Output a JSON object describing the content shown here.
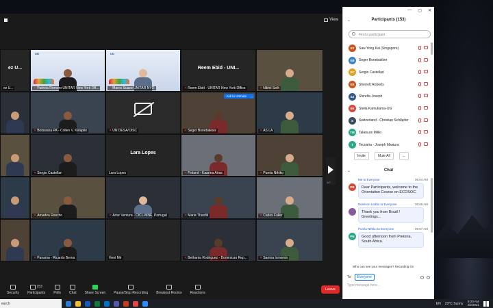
{
  "meeting": {
    "view_label": "View",
    "tiles": [
      {
        "id": "t0",
        "name": "ez U...",
        "kind": "big",
        "big": "ez U...",
        "mic": false
      },
      {
        "id": "t1",
        "name": "Patricia Romero UNITAR New York Off...",
        "kind": "slide",
        "mic": true
      },
      {
        "id": "t2",
        "name": "Marco Suazo UNITAR NYO",
        "kind": "slide",
        "mic": true
      },
      {
        "id": "t3",
        "name": "Reem Ebid - UNITAR New York Office",
        "kind": "big",
        "big": "Reem Ebid - UNI...",
        "mic": true
      },
      {
        "id": "t4",
        "name": "Nikhil Seth",
        "kind": "person",
        "mic": true
      },
      {
        "id": "t5",
        "name": "",
        "kind": "person",
        "mic": false
      },
      {
        "id": "t6",
        "name": "Botswana PA - Collen V. Kelapile",
        "kind": "person",
        "mic": true
      },
      {
        "id": "t7",
        "name": "UN DESA/OISC",
        "kind": "camoff",
        "mic": true
      },
      {
        "id": "t8",
        "name": "Seger Bonebakker",
        "kind": "person",
        "mic": true,
        "unmute": "Ask to Unmute",
        "more": "..."
      },
      {
        "id": "t9",
        "name": "AS LA",
        "kind": "person",
        "mic": true
      },
      {
        "id": "t10",
        "name": "",
        "kind": "person",
        "mic": false
      },
      {
        "id": "t11",
        "name": "Sergio Castellari",
        "kind": "person",
        "mic": true
      },
      {
        "id": "t12",
        "name": "Lara Lopes",
        "kind": "big",
        "big": "Lara Lopes",
        "mic": false
      },
      {
        "id": "t13",
        "name": "Finland - Kaarina Airas",
        "kind": "person",
        "mic": true
      },
      {
        "id": "t14",
        "name": "Pumla Nthiko",
        "kind": "person",
        "mic": true
      },
      {
        "id": "t15",
        "name": "",
        "kind": "person",
        "mic": false
      },
      {
        "id": "t16",
        "name": "Amadea Rascho",
        "kind": "person",
        "mic": true
      },
      {
        "id": "t17",
        "name": "Artur Ventura - CICL-MNE, Portugal",
        "kind": "person",
        "mic": true
      },
      {
        "id": "t18",
        "name": "Maria Theofili",
        "kind": "person",
        "mic": true
      },
      {
        "id": "t19",
        "name": "Carlos Fuller",
        "kind": "person",
        "mic": true
      },
      {
        "id": "t20",
        "name": "",
        "kind": "person",
        "mic": false
      },
      {
        "id": "t21",
        "name": "Panama - Ricardo Berna",
        "kind": "person",
        "mic": true
      },
      {
        "id": "t22",
        "name": "Heni Mir",
        "kind": "dark",
        "mic": false
      },
      {
        "id": "t23",
        "name": "Bethania Rodriguez - Dominican Rep...",
        "kind": "person",
        "mic": true
      },
      {
        "id": "t24",
        "name": "Samira Ismomin",
        "kind": "person",
        "mic": true
      }
    ],
    "pager": "1/7",
    "toolbar": [
      {
        "id": "security",
        "label": "Security"
      },
      {
        "id": "participants",
        "label": "Participants",
        "count": "153"
      },
      {
        "id": "polls",
        "label": "Polls"
      },
      {
        "id": "chat",
        "label": "Chat"
      },
      {
        "id": "share",
        "label": "Share Screen"
      },
      {
        "id": "record",
        "label": "Pause/Stop Recording"
      },
      {
        "id": "breakout",
        "label": "Breakout Rooms"
      },
      {
        "id": "reactions",
        "label": "Reactions"
      }
    ],
    "leave_label": "Leave"
  },
  "panel": {
    "title": "Participants (153)",
    "find_placeholder": "Find a participant",
    "participants": [
      {
        "initials": "SY",
        "name": "Saw Yong Kai (Singapore)",
        "color": "#c8541e"
      },
      {
        "initials": "SB",
        "name": "Seger Bonebakker",
        "color": "#3b82c4"
      },
      {
        "initials": "SC",
        "name": "Sergio Castellari",
        "color": "#e0a020"
      },
      {
        "initials": "SR",
        "name": "Sherrett Roberts",
        "color": "#c8541e"
      },
      {
        "initials": "SJ",
        "name": "Shirelfa Joseph",
        "color": "#335a8c"
      },
      {
        "initials": "SK",
        "name": "Stella Kamukama-UG",
        "color": "#d44a3a"
      },
      {
        "initials": "S",
        "name": "Switzerland - Christian Schläpfer",
        "color": "#3c4b5c"
      },
      {
        "initials": "TM",
        "name": "Takesure Mililo",
        "color": "#2aa88a"
      },
      {
        "initials": "T",
        "name": "Tecnaria - Joseph Mwaura",
        "color": "#2aa88a"
      }
    ],
    "invite_label": "Invite",
    "mute_all_label": "Mute All",
    "more_label": "...",
    "chat_title": "Chat",
    "messages": [
      {
        "from": "Me to Everyone",
        "time": "09:04 AM",
        "initials": "PR",
        "color": "#d44a3a",
        "text": "Dear Participants, welcome to the Orientation Course on ECOSOC."
      },
      {
        "from": "Denilson Ledão to Everyone",
        "time": "09:08 AM",
        "initials": "",
        "color": "#8a5a9c",
        "text": "Thank you from Brazil ! Greetings..."
      },
      {
        "from": "Pumla Nthiko to Everyone",
        "time": "09:07 AM",
        "initials": "PN",
        "color": "#2aa88a",
        "text": "Good afternoon from Pretoria, South Africa."
      }
    ],
    "who_label": "Who can see your messages? Recording On",
    "to_label": "To:",
    "to_value": "Everyone",
    "message_placeholder": "Type message here..."
  },
  "taskbar": {
    "search_text": "earch",
    "lang": "EN",
    "weather": "23°C  Sunny",
    "time": "9:20 AM",
    "date": "4/2/2021"
  }
}
